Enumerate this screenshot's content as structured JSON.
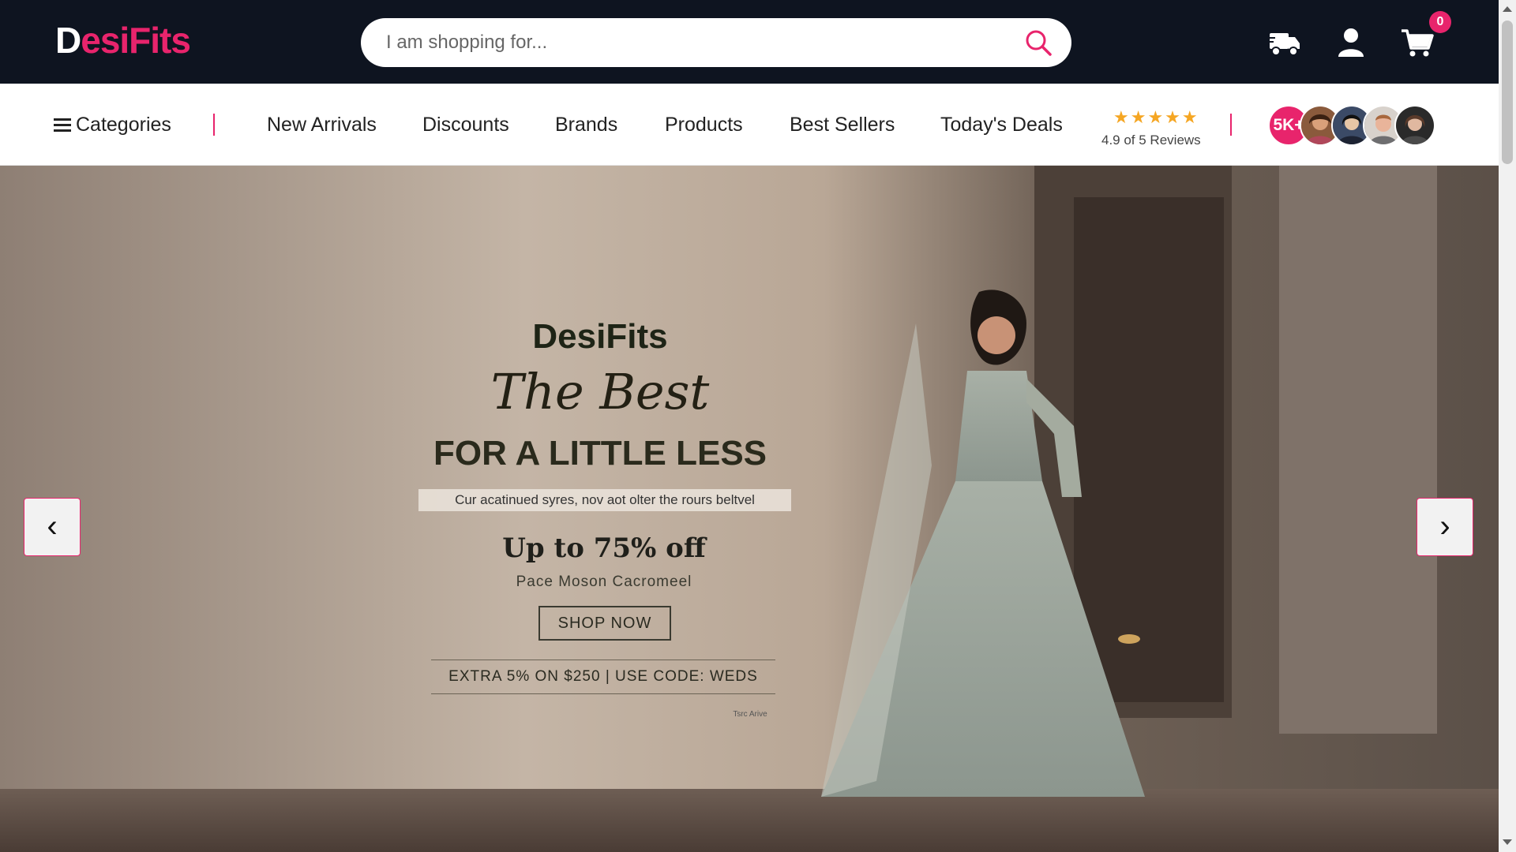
{
  "header": {
    "logo_first": "D",
    "logo_rest": "esiFits",
    "search_placeholder": "I am shopping for...",
    "cart_count": "0",
    "icons": [
      "search-icon",
      "delivery-truck-icon",
      "user-icon",
      "cart-icon"
    ]
  },
  "nav": {
    "categories_label": "Categories",
    "links": [
      "New Arrivals",
      "Discounts",
      "Brands",
      "Products",
      "Best Sellers",
      "Today's Deals"
    ],
    "stars": "★★★★★",
    "rating_text": "4.9 of 5 Reviews",
    "customers_badge": "5K+"
  },
  "hero": {
    "brand": "DesiFits",
    "script_title": "The Best",
    "tagline": "FOR A LITTLE LESS",
    "small_line": "Cur acatinued syres, nov aot olter the rours beltvel",
    "offer": "Up to 75% off",
    "offer_sub": "Pace Moson Cacromeel",
    "cta": "SHOP NOW",
    "code_line": "EXTRA 5% ON $250 | USE CODE: WEDS",
    "fine_print": "Tsrc Arive",
    "prev": "‹",
    "next": "›"
  },
  "colors": {
    "header_bg": "#0e1420",
    "accent": "#e8246c",
    "star": "#f5a623"
  }
}
